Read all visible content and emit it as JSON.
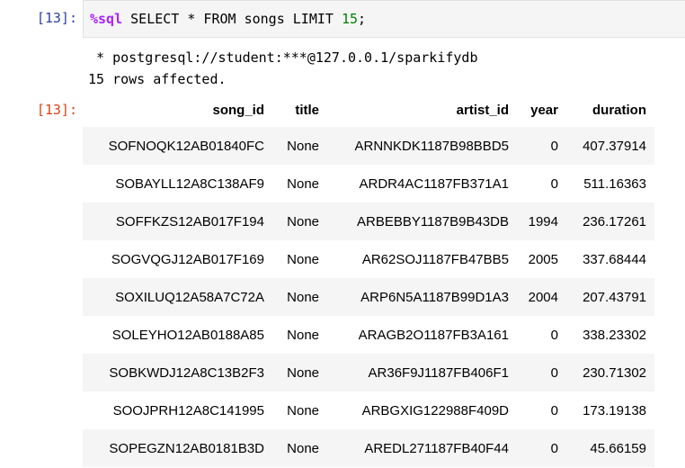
{
  "input_prompt": "[13]:",
  "code": {
    "magic": "%sql",
    "query_before_num": " SELECT * FROM songs LIMIT ",
    "limit": "15",
    "tail": ";"
  },
  "stdout": {
    "connection": " * postgresql://student:***@127.0.0.1/sparkifydb",
    "rows_affected": "15 rows affected."
  },
  "output_prompt": "[13]:",
  "table": {
    "headers": [
      "song_id",
      "title",
      "artist_id",
      "year",
      "duration"
    ],
    "rows": [
      [
        "SOFNOQK12AB01840FC",
        "None",
        "ARNNKDK1187B98BBD5",
        "0",
        "407.37914"
      ],
      [
        "SOBAYLL12A8C138AF9",
        "None",
        "ARDR4AC1187FB371A1",
        "0",
        "511.16363"
      ],
      [
        "SOFFKZS12AB017F194",
        "None",
        "ARBEBBY1187B9B43DB",
        "1994",
        "236.17261"
      ],
      [
        "SOGVQGJ12AB017F169",
        "None",
        "AR62SOJ1187FB47BB5",
        "2005",
        "337.68444"
      ],
      [
        "SOXILUQ12A58A7C72A",
        "None",
        "ARP6N5A1187B99D1A3",
        "2004",
        "207.43791"
      ],
      [
        "SOLEYHO12AB0188A85",
        "None",
        "ARAGB2O1187FB3A161",
        "0",
        "338.23302"
      ],
      [
        "SOBKWDJ12A8C13B2F3",
        "None",
        "AR36F9J1187FB406F1",
        "0",
        "230.71302"
      ],
      [
        "SOOJPRH12A8C141995",
        "None",
        "ARBGXIG122988F409D",
        "0",
        "173.19138"
      ],
      [
        "SOPEGZN12AB0181B3D",
        "None",
        "AREDL271187FB40F44",
        "0",
        "45.66159"
      ]
    ]
  }
}
